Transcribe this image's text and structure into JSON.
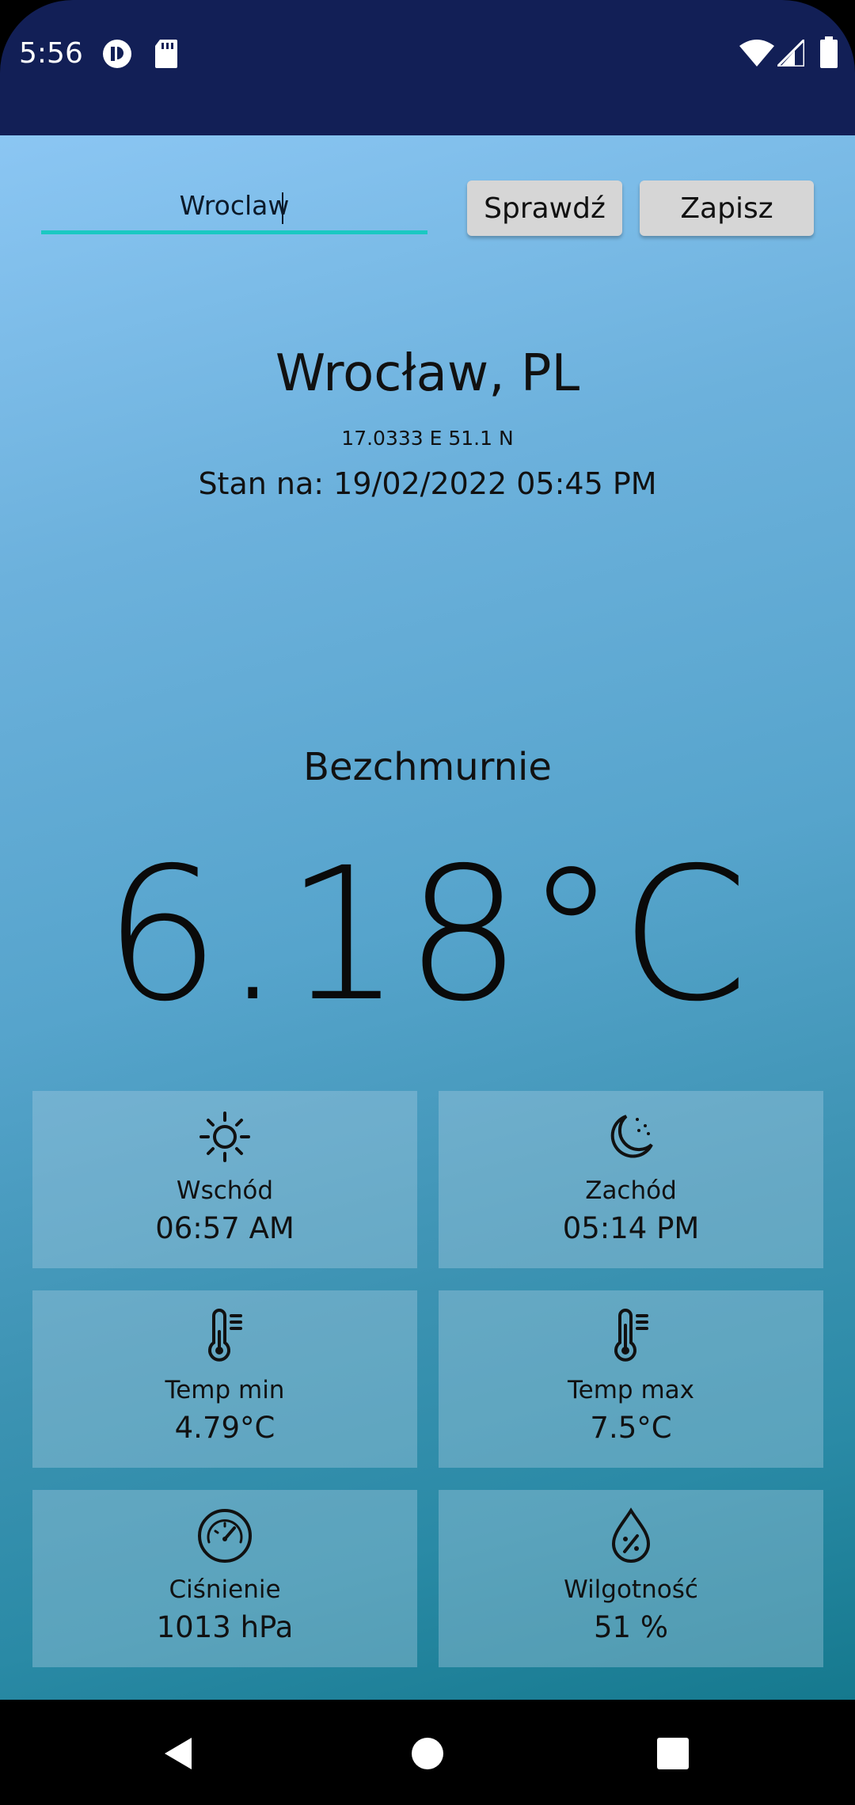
{
  "status_bar": {
    "time": "5:56",
    "icons": [
      "app-notification-icon",
      "sd-card-icon",
      "wifi-icon",
      "cell-signal-icon",
      "battery-icon"
    ]
  },
  "search": {
    "value": "Wroclaw",
    "check_label": "Sprawdź",
    "save_label": "Zapisz"
  },
  "location": {
    "city": "Wrocław, PL",
    "coordinates": "17.0333 E 51.1 N",
    "updated": "Stan na: 19/02/2022 05:45 PM"
  },
  "weather": {
    "description": "Bezchmurnie",
    "temperature": "6.18°C"
  },
  "details": [
    {
      "icon": "sunrise-icon",
      "label": "Wschód",
      "value": "06:57 AM"
    },
    {
      "icon": "sunset-moon-icon",
      "label": "Zachód",
      "value": "05:14 PM"
    },
    {
      "icon": "thermometer-icon",
      "label": "Temp min",
      "value": "4.79°C"
    },
    {
      "icon": "thermometer-icon",
      "label": "Temp max",
      "value": "7.5°C"
    },
    {
      "icon": "pressure-gauge-icon",
      "label": "Ciśnienie",
      "value": "1013 hPa"
    },
    {
      "icon": "humidity-drop-icon",
      "label": "Wilgotność",
      "value": "51 %"
    }
  ],
  "colors": {
    "status_bar": "#121f56",
    "accent_underline": "#1bc8c2",
    "button_bg": "#d6d6d6"
  },
  "nav_bar": {
    "icons": [
      "back-icon",
      "home-icon",
      "recents-icon"
    ]
  }
}
